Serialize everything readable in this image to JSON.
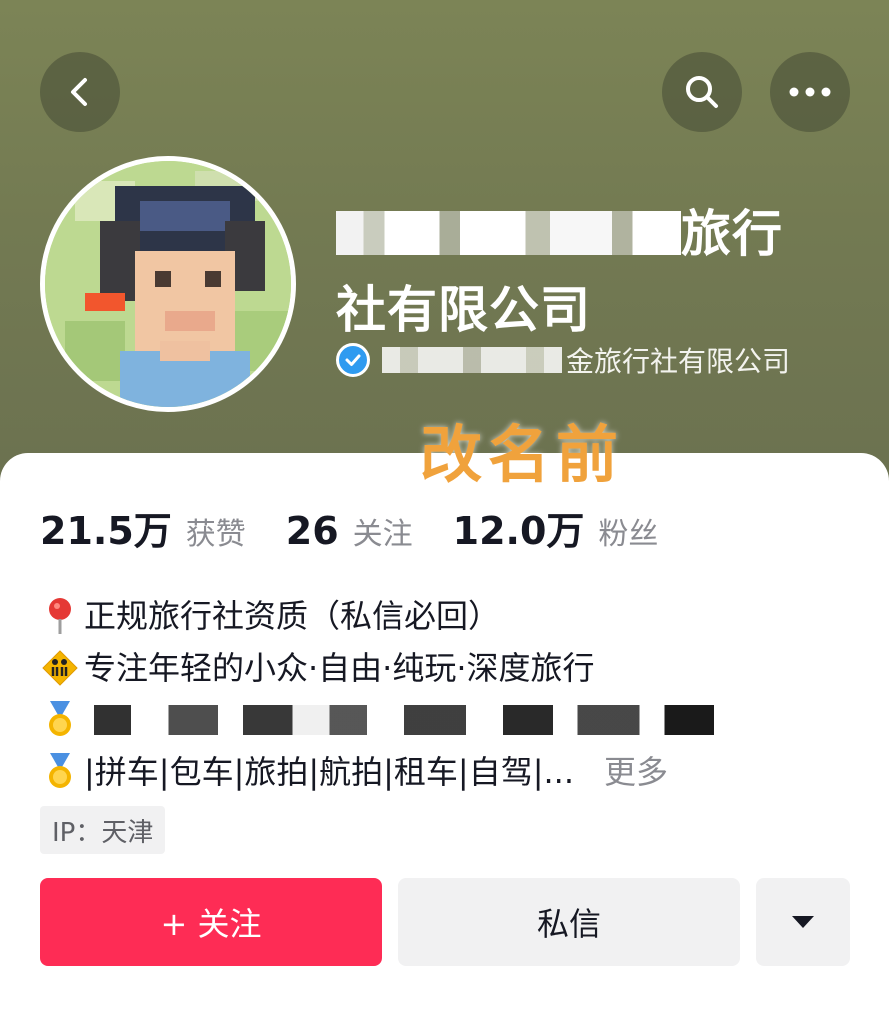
{
  "profile": {
    "name_line1_suffix": "旅行",
    "name_line2": "社有限公司",
    "verified_suffix": "金旅行社有限公司"
  },
  "overlay_label": "改名前",
  "stats": [
    {
      "value": "21.5万",
      "label": "获赞"
    },
    {
      "value": "26",
      "label": "关注"
    },
    {
      "value": "12.0万",
      "label": "粉丝"
    }
  ],
  "bio": {
    "line1": "正规旅行社资质（私信必回）",
    "line2": "专注年轻的小众·自由·纯玩·深度旅行",
    "line4": "|拼车|包车|旅拍|航拍|租车|自驾|...",
    "more": "更多"
  },
  "ip": "IP：天津",
  "actions": {
    "follow": "+ 关注",
    "message": "私信"
  },
  "icons": {
    "back": "chevron-left-icon",
    "search": "search-icon",
    "more": "more-dots-icon",
    "verified": "verified-check-icon",
    "location": "pin-icon",
    "dropdown": "caret-down-icon"
  },
  "colors": {
    "header": "#737a52",
    "follow_button": "#fe2c55",
    "verified": "#2f9bf0",
    "overlay_label": "#f0a23c"
  }
}
